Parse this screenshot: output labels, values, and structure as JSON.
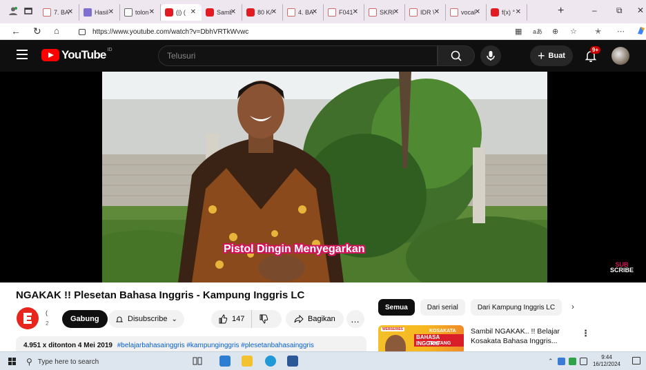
{
  "browser": {
    "tabs": [
      {
        "title": "7. BA",
        "type": "doc"
      },
      {
        "title": "Hasil",
        "type": "word"
      },
      {
        "title": "tolon",
        "type": "img"
      },
      {
        "title": "(|) (",
        "type": "yt",
        "active": true
      },
      {
        "title": "Samb",
        "type": "yt"
      },
      {
        "title": "80 K/",
        "type": "yt"
      },
      {
        "title": "4. BA",
        "type": "doc"
      },
      {
        "title": "F041",
        "type": "doc"
      },
      {
        "title": "SKRI",
        "type": "doc"
      },
      {
        "title": "IDR \\",
        "type": "doc"
      },
      {
        "title": "vocal",
        "type": "doc"
      },
      {
        "title": "f(x) °",
        "type": "yt"
      }
    ],
    "new_tab": "+",
    "url": "https://www.youtube.com/watch?v=DbhVRTkWvwc",
    "reader_label": "aあ"
  },
  "youtube": {
    "logo_text": "YouTube",
    "country_code": "ID",
    "search_placeholder": "Telusuri",
    "create_label": "Buat",
    "notification_badge": "9+",
    "video": {
      "caption": "Pistol Dingin Menyegarkan",
      "watermark_top": "SUB",
      "watermark_bottom": "SCRIBE",
      "title": "NGAKAK !! Plesetan Bahasa Inggris - Kampung Inggris LC",
      "channel_name_partial": "(",
      "channel_sub_partial": "2",
      "join_label": "Gabung",
      "subscribed_label": "Disubscribe",
      "likes": "147",
      "share_label": "Bagikan",
      "more_label": "…",
      "views": "4.951 x ditonton",
      "date": "4 Mei 2019",
      "hashtags": "#belajarbahasainggris #kampunginggris #plesetanbahasainggris"
    },
    "chips": [
      "Semua",
      "Dari serial",
      "Dari Kampung Inggris LC"
    ],
    "suggested": {
      "title": "Sambil NGAKAK.. !! Belajar Kosakata Bahasa Inggris...",
      "thumb_line1": "KOSAKATA",
      "thumb_line2": "BAHASA INGGRIS",
      "thumb_line3": "TENTANG",
      "thumb_badge": "WEBSERIES"
    }
  },
  "taskbar": {
    "search_placeholder": "Type here to search",
    "time": "9:44",
    "date": "16/12/2024"
  },
  "colors": {
    "yt_red": "#ff0000",
    "yt_dark": "#0f0f0f",
    "caption_outline": "#d4145a",
    "link_blue": "#065fd4"
  }
}
